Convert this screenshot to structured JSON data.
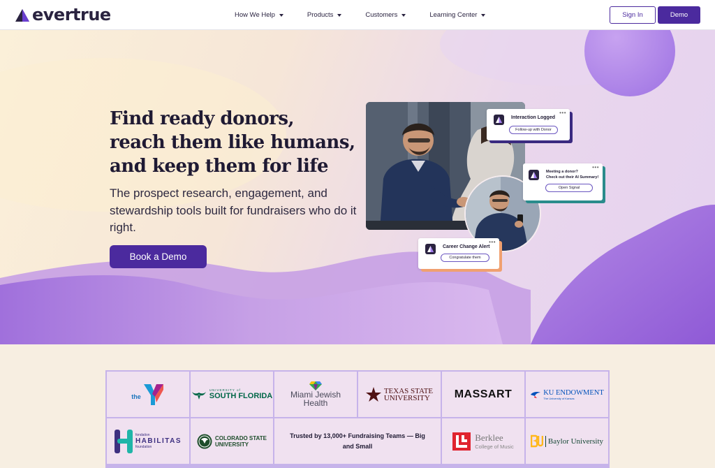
{
  "brand": {
    "name": "evertrue",
    "color": "#4b2a9e",
    "ink": "#1f1a33"
  },
  "nav": {
    "items": [
      {
        "label": "How We Help"
      },
      {
        "label": "Products"
      },
      {
        "label": "Customers"
      },
      {
        "label": "Learning Center"
      }
    ],
    "signin_label": "Sign In",
    "demo_label": "Demo"
  },
  "hero": {
    "title_lines": [
      "Find ready donors,",
      "reach them like humans,",
      "and keep them for life"
    ],
    "subtitle": "The prospect research, engagement, and stewardship tools built for fundraisers who do it right.",
    "cta_label": "Book a Demo",
    "cards": {
      "interaction": {
        "title": "Interaction Logged",
        "button": "Follow-up with Donor",
        "accent": "#3a2a80"
      },
      "meeting": {
        "title_line1": "Meeting a donor?",
        "title_line2": "Check out their AI Summary!",
        "button": "Open Signal",
        "accent": "#2a8c8c"
      },
      "career": {
        "title": "Career Change Alert",
        "button": "Congratulate them",
        "accent": "#f0a070"
      }
    }
  },
  "customers": {
    "trusted_text": "Trusted by 13,000+ Fundraising Teams — Big and Small",
    "logos": {
      "ymca": {
        "text": "the"
      },
      "usf": {
        "top": "UNIVERSITY of",
        "main": "SOUTH FLORIDA"
      },
      "miami": {
        "line1": "Miami Jewish",
        "line2": "Health"
      },
      "texas": {
        "line1": "TEXAS STATE",
        "line2": "UNIVERSITY"
      },
      "massart": {
        "text": "MASSART"
      },
      "ku": {
        "line1": "KU ENDOWMENT",
        "line2": "The University of Kansas"
      },
      "habilitas": {
        "top": "fondation",
        "main": "HABILITAS",
        "bottom": "foundation"
      },
      "csu": {
        "line1": "COLORADO STATE",
        "line2": "UNIVERSITY"
      },
      "berklee": {
        "line1": "Berklee",
        "line2": "College of Music"
      },
      "baylor": {
        "text": "Baylor University"
      }
    }
  }
}
